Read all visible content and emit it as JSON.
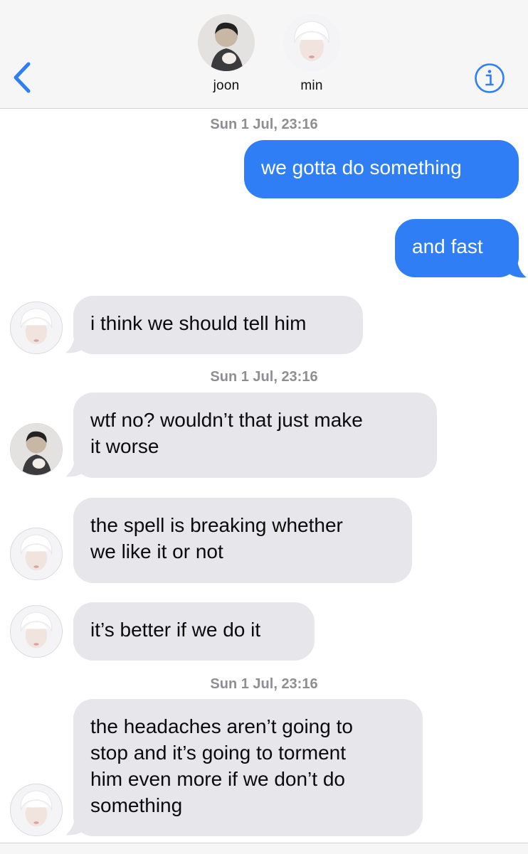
{
  "colors": {
    "accent": "#2f7ef5",
    "incoming": "#e6e6eb",
    "timestamp": "#8e8e93"
  },
  "header": {
    "back_icon": "chevron-left-icon",
    "info_icon": "info-icon",
    "contacts": [
      {
        "name": "joon",
        "avatar_icon": "avatar-joon"
      },
      {
        "name": "min",
        "avatar_icon": "avatar-min"
      }
    ]
  },
  "conversation": {
    "timestamps": [
      {
        "day": "Sun 1 Jul,",
        "time": "23:16"
      },
      {
        "day": "Sun 1 Jul,",
        "time": "23:16"
      },
      {
        "day": "Sun 1 Jul,",
        "time": "23:16"
      }
    ],
    "messages": [
      {
        "sender": "me",
        "text": "we gotta do something"
      },
      {
        "sender": "me",
        "text": "and fast"
      },
      {
        "sender": "min",
        "text": "i think we should tell him"
      },
      {
        "sender": "joon",
        "lines": [
          "wtf no? wouldn’t that just make",
          "it worse"
        ]
      },
      {
        "sender": "min",
        "lines": [
          "the spell is breaking whether",
          "we like it or not"
        ]
      },
      {
        "sender": "min",
        "text": "it’s better if we do it"
      },
      {
        "sender": "min",
        "lines": [
          "the headaches aren’t going to",
          "stop and it’s going to torment",
          "him even more if we don’t do",
          "something"
        ]
      }
    ]
  }
}
